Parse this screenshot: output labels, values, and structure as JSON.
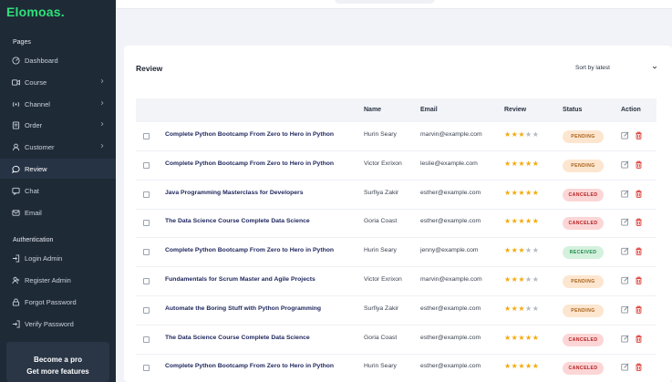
{
  "sidebar": {
    "logo": "Elomoas.",
    "pages_title": "Pages",
    "items": [
      {
        "label": "Dashboard",
        "icon": "dashboard-icon",
        "chevron": false
      },
      {
        "label": "Course",
        "icon": "video-icon",
        "chevron": true
      },
      {
        "label": "Channel",
        "icon": "broadcast-icon",
        "chevron": true
      },
      {
        "label": "Order",
        "icon": "order-icon",
        "chevron": true
      },
      {
        "label": "Customer",
        "icon": "user-icon",
        "chevron": true
      },
      {
        "label": "Review",
        "icon": "chat-bubble-icon",
        "chevron": false,
        "active": true
      },
      {
        "label": "Chat",
        "icon": "chat-icon",
        "chevron": false
      },
      {
        "label": "Email",
        "icon": "mail-icon",
        "chevron": false
      }
    ],
    "auth_title": "Authentication",
    "auth_items": [
      {
        "label": "Login Admin",
        "icon": "login-icon"
      },
      {
        "label": "Register Admin",
        "icon": "register-icon"
      },
      {
        "label": "Forgot Password",
        "icon": "lock-icon"
      },
      {
        "label": "Verify Password",
        "icon": "verify-icon"
      }
    ],
    "promo": {
      "line1": "Become a pro",
      "line2": "Get more features"
    }
  },
  "review": {
    "title": "Review",
    "sort_label": "Sort by latest",
    "columns": {
      "name": "Name",
      "email": "Email",
      "review": "Review",
      "status": "Status",
      "action": "Action"
    },
    "rows": [
      {
        "course": "Complete Python Bootcamp From Zero to Hero in Python",
        "name": "Hurin Seary",
        "email": "marvin@example.com",
        "rating": 3,
        "status": "PENDING",
        "status_type": "pending"
      },
      {
        "course": "Complete Python Bootcamp From Zero to Hero in Python",
        "name": "Victor Exrixon",
        "email": "leslie@example.com",
        "rating": 5,
        "status": "PENDING",
        "status_type": "pending"
      },
      {
        "course": "Java Programming Masterclass for Developers",
        "name": "Surfiya Zakir",
        "email": "esther@example.com",
        "rating": 5,
        "status": "CANCELED",
        "status_type": "canceled"
      },
      {
        "course": "The Data Science Course Complete Data Science",
        "name": "Goria Coast",
        "email": "esther@example.com",
        "rating": 5,
        "status": "CANCELED",
        "status_type": "canceled"
      },
      {
        "course": "Complete Python Bootcamp From Zero to Hero in Python",
        "name": "Hurin Seary",
        "email": "jenny@example.com",
        "rating": 3,
        "status": "RECEIVED",
        "status_type": "received"
      },
      {
        "course": "Fundamentals for Scrum Master and Agile Projects",
        "name": "Victor Exrixon",
        "email": "marvin@example.com",
        "rating": 3,
        "status": "PENDING",
        "status_type": "pending"
      },
      {
        "course": "Automate the Boring Stuff with Python Programming",
        "name": "Surfiya Zakir",
        "email": "esther@example.com",
        "rating": 3,
        "status": "PENDING",
        "status_type": "pending"
      },
      {
        "course": "The Data Science Course Complete Data Science",
        "name": "Goria Coast",
        "email": "esther@example.com",
        "rating": 5,
        "status": "CANCELED",
        "status_type": "canceled"
      },
      {
        "course": "Complete Python Bootcamp From Zero to Hero in Python",
        "name": "Hurin Seary",
        "email": "esther@example.com",
        "rating": 5,
        "status": "CANCELED",
        "status_type": "canceled"
      }
    ]
  },
  "colors": {
    "star_on": "#f5a90a",
    "star_off": "#b5bac2",
    "logo": "#2ee27a",
    "sidebar_bg": "#1f2a37"
  }
}
